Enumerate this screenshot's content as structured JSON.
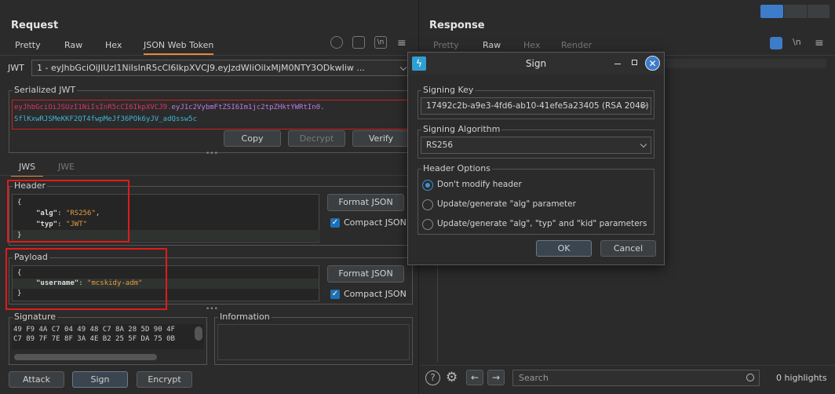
{
  "request": {
    "title": "Request",
    "tabs": [
      "Pretty",
      "Raw",
      "Hex",
      "JSON Web Token"
    ],
    "jwt_label": "JWT",
    "jwt_select": "1 - eyJhbGciOiJIUzI1NiIsInR5cCI6IkpXVCJ9.eyJzdWIiOiIxMjM0NTY3ODkwIiw ...",
    "serialized_title": "Serialized JWT",
    "serialized_part1": "eyJhbGciOiJSUzI1NiIsInR5cCI6IkpXVCJ9.",
    "serialized_part2": "eyJ1c2VybmFtZSI6Im1jc2tpZHktYWRtIn0.",
    "serialized_part3": "SflKxwRJSMeKKF2QT4fwpMeJf36POk6yJV_adQssw5c",
    "copy": "Copy",
    "decrypt": "Decrypt",
    "verify": "Verify",
    "jws": "JWS",
    "jwe": "JWE",
    "header_title": "Header",
    "header_lines": [
      "{",
      "\"alg\": \"RS256\",",
      "\"typ\": \"JWT\"",
      "}"
    ],
    "header_l1_key": "\"alg\"",
    "header_l1_val": "\"RS256\"",
    "header_l2_key": "\"typ\"",
    "header_l2_val": "\"JWT\"",
    "brace_open": "{",
    "brace_close": "}",
    "format_json": "Format JSON",
    "compact_json": "Compact JSON",
    "payload_title": "Payload",
    "payload_key": "\"username\"",
    "payload_val": "\"mcskidy-adm\"",
    "signature_title": "Signature",
    "signature_line1": "49 F9 4A C7 04 49 48 C7 8A 28 5D 90 4F",
    "signature_line2": "C7 89 7F 7E 8F 3A 4E B2 25 5F DA 75 0B",
    "information_title": "Information",
    "attack": "Attack",
    "sign": "Sign",
    "encrypt": "Encrypt"
  },
  "response": {
    "title": "Response",
    "tabs": [
      "Pretty",
      "Raw",
      "Hex",
      "Render"
    ],
    "search_placeholder": "Search",
    "highlights": "0 highlights",
    "newline_icon": "\\n"
  },
  "dialog": {
    "title": "Sign",
    "signing_key_title": "Signing Key",
    "signing_key_value": "17492c2b-a9e3-4fd6-ab10-41efe5a23405 (RSA 2048)",
    "signing_alg_title": "Signing Algorithm",
    "signing_alg_value": "RS256",
    "header_options_title": "Header Options",
    "opt1": "Don't modify header",
    "opt2": "Update/generate \"alg\" parameter",
    "opt3": "Update/generate \"alg\", \"typ\" and \"kid\" parameters",
    "ok": "OK",
    "cancel": "Cancel"
  },
  "colors": {
    "accent": "#e8873a",
    "highlight": "#e01b1b",
    "blue": "#3d8fd6"
  }
}
